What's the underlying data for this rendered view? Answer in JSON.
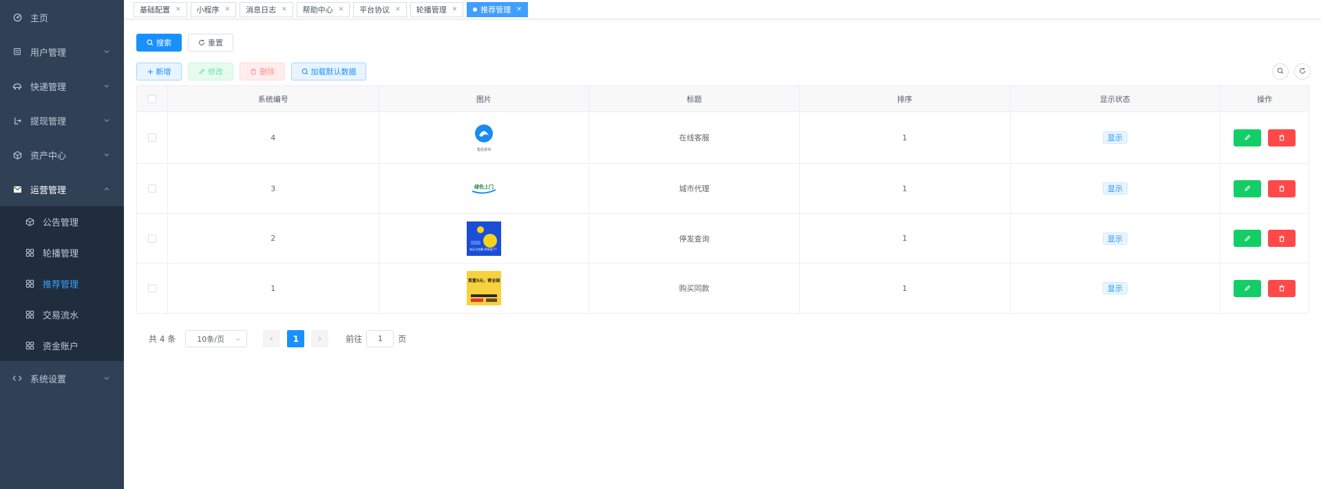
{
  "sidebar": {
    "items": [
      {
        "label": "主页",
        "icon": "dashboard-icon"
      },
      {
        "label": "用户管理",
        "icon": "user-list-icon"
      },
      {
        "label": "快递管理",
        "icon": "truck-icon"
      },
      {
        "label": "提现管理",
        "icon": "withdraw-icon"
      },
      {
        "label": "资产中心",
        "icon": "cube-icon"
      },
      {
        "label": "运营管理",
        "icon": "mail-icon"
      },
      {
        "label": "系统设置",
        "icon": "code-icon"
      }
    ],
    "sub_items": [
      {
        "label": "公告管理",
        "icon": "cube-icon"
      },
      {
        "label": "轮播管理",
        "icon": "grid-icon"
      },
      {
        "label": "推荐管理",
        "icon": "grid-icon"
      },
      {
        "label": "交易流水",
        "icon": "grid-icon"
      },
      {
        "label": "资金账户",
        "icon": "grid-icon"
      }
    ]
  },
  "tags": [
    {
      "label": "基础配置"
    },
    {
      "label": "小程序"
    },
    {
      "label": "消息日志"
    },
    {
      "label": "帮助中心"
    },
    {
      "label": "平台协议"
    },
    {
      "label": "轮播管理"
    },
    {
      "label": "推荐管理"
    }
  ],
  "toolbar": {
    "search": "搜索",
    "reset": "重置",
    "add": "新增",
    "edit": "修改",
    "delete": "删除",
    "load_default": "加载默认数据"
  },
  "table": {
    "headers": [
      "系统编号",
      "图片",
      "标题",
      "排序",
      "显示状态",
      "操作"
    ],
    "rows": [
      {
        "id": "4",
        "title": "在线客服",
        "sort": "1",
        "status": "显示",
        "image": "customer-service-image",
        "image_caption": "售后咨询"
      },
      {
        "id": "3",
        "title": "城市代理",
        "sort": "1",
        "status": "显示",
        "image": "city-agent-image",
        "image_caption": "绿色上门"
      },
      {
        "id": "2",
        "title": "停发查询",
        "sort": "1",
        "status": "显示",
        "image": "stop-query-image",
        "image_caption": "有无卡包裹 停发谁了?"
      },
      {
        "id": "1",
        "title": "购买同款",
        "sort": "1",
        "status": "显示",
        "image": "buy-same-image",
        "image_caption": "首重5元，寄全国"
      }
    ]
  },
  "pagination": {
    "total": "共 4 条",
    "page_size": "10条/页",
    "current": "1",
    "goto_prefix": "前往",
    "goto_value": "1",
    "goto_suffix": "页"
  },
  "colors": {
    "sidebar_bg": "#304156",
    "primary": "#1890ff",
    "success": "#13ce66",
    "danger": "#ff4949"
  }
}
